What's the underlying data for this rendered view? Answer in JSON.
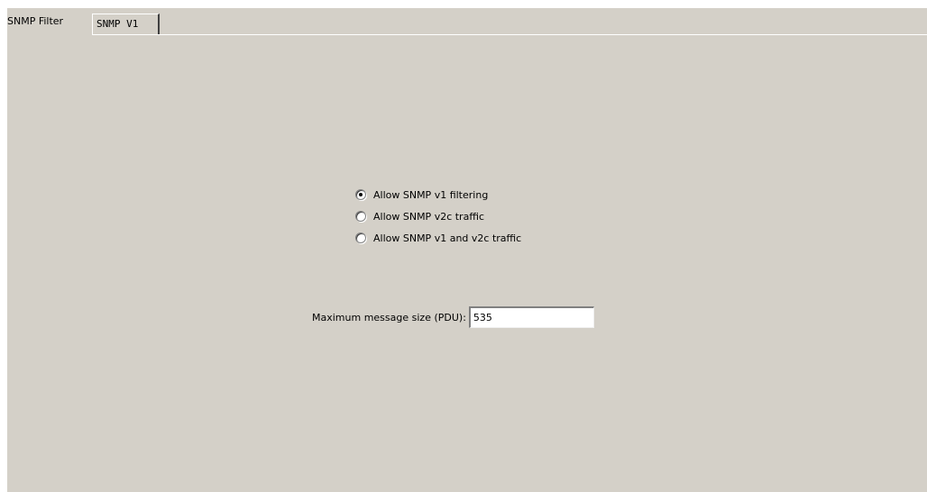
{
  "tabs": [
    {
      "label": "SNMP Filter",
      "active": true
    },
    {
      "label": "SNMP V1",
      "active": false
    }
  ],
  "radio_options": [
    {
      "label": "Allow SNMP v1 filtering",
      "checked": true
    },
    {
      "label": "Allow SNMP v2c traffic",
      "checked": false
    },
    {
      "label": "Allow SNMP v1 and v2c traffic",
      "checked": false
    }
  ],
  "pdu": {
    "label": "Maximum message size (PDU):",
    "value": "535"
  }
}
